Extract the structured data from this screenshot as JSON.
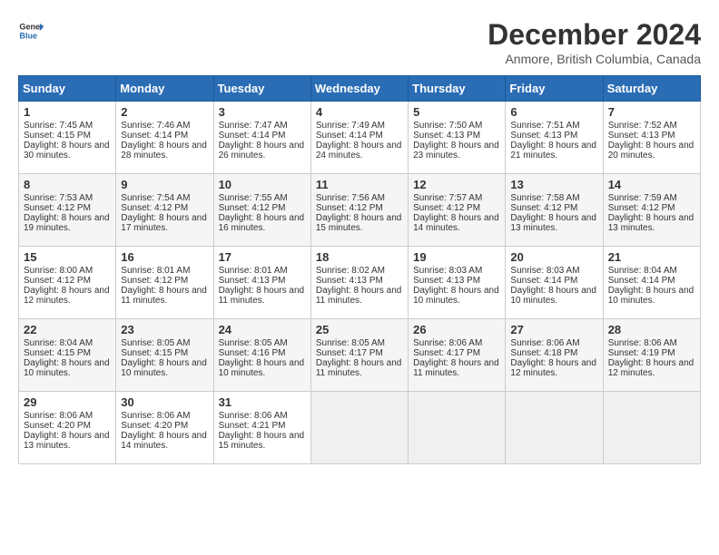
{
  "header": {
    "logo_line1": "General",
    "logo_line2": "Blue",
    "month": "December 2024",
    "location": "Anmore, British Columbia, Canada"
  },
  "weekdays": [
    "Sunday",
    "Monday",
    "Tuesday",
    "Wednesday",
    "Thursday",
    "Friday",
    "Saturday"
  ],
  "weeks": [
    [
      {
        "day": "1",
        "sunrise": "Sunrise: 7:45 AM",
        "sunset": "Sunset: 4:15 PM",
        "daylight": "Daylight: 8 hours and 30 minutes."
      },
      {
        "day": "2",
        "sunrise": "Sunrise: 7:46 AM",
        "sunset": "Sunset: 4:14 PM",
        "daylight": "Daylight: 8 hours and 28 minutes."
      },
      {
        "day": "3",
        "sunrise": "Sunrise: 7:47 AM",
        "sunset": "Sunset: 4:14 PM",
        "daylight": "Daylight: 8 hours and 26 minutes."
      },
      {
        "day": "4",
        "sunrise": "Sunrise: 7:49 AM",
        "sunset": "Sunset: 4:14 PM",
        "daylight": "Daylight: 8 hours and 24 minutes."
      },
      {
        "day": "5",
        "sunrise": "Sunrise: 7:50 AM",
        "sunset": "Sunset: 4:13 PM",
        "daylight": "Daylight: 8 hours and 23 minutes."
      },
      {
        "day": "6",
        "sunrise": "Sunrise: 7:51 AM",
        "sunset": "Sunset: 4:13 PM",
        "daylight": "Daylight: 8 hours and 21 minutes."
      },
      {
        "day": "7",
        "sunrise": "Sunrise: 7:52 AM",
        "sunset": "Sunset: 4:13 PM",
        "daylight": "Daylight: 8 hours and 20 minutes."
      }
    ],
    [
      {
        "day": "8",
        "sunrise": "Sunrise: 7:53 AM",
        "sunset": "Sunset: 4:12 PM",
        "daylight": "Daylight: 8 hours and 19 minutes."
      },
      {
        "day": "9",
        "sunrise": "Sunrise: 7:54 AM",
        "sunset": "Sunset: 4:12 PM",
        "daylight": "Daylight: 8 hours and 17 minutes."
      },
      {
        "day": "10",
        "sunrise": "Sunrise: 7:55 AM",
        "sunset": "Sunset: 4:12 PM",
        "daylight": "Daylight: 8 hours and 16 minutes."
      },
      {
        "day": "11",
        "sunrise": "Sunrise: 7:56 AM",
        "sunset": "Sunset: 4:12 PM",
        "daylight": "Daylight: 8 hours and 15 minutes."
      },
      {
        "day": "12",
        "sunrise": "Sunrise: 7:57 AM",
        "sunset": "Sunset: 4:12 PM",
        "daylight": "Daylight: 8 hours and 14 minutes."
      },
      {
        "day": "13",
        "sunrise": "Sunrise: 7:58 AM",
        "sunset": "Sunset: 4:12 PM",
        "daylight": "Daylight: 8 hours and 13 minutes."
      },
      {
        "day": "14",
        "sunrise": "Sunrise: 7:59 AM",
        "sunset": "Sunset: 4:12 PM",
        "daylight": "Daylight: 8 hours and 13 minutes."
      }
    ],
    [
      {
        "day": "15",
        "sunrise": "Sunrise: 8:00 AM",
        "sunset": "Sunset: 4:12 PM",
        "daylight": "Daylight: 8 hours and 12 minutes."
      },
      {
        "day": "16",
        "sunrise": "Sunrise: 8:01 AM",
        "sunset": "Sunset: 4:12 PM",
        "daylight": "Daylight: 8 hours and 11 minutes."
      },
      {
        "day": "17",
        "sunrise": "Sunrise: 8:01 AM",
        "sunset": "Sunset: 4:13 PM",
        "daylight": "Daylight: 8 hours and 11 minutes."
      },
      {
        "day": "18",
        "sunrise": "Sunrise: 8:02 AM",
        "sunset": "Sunset: 4:13 PM",
        "daylight": "Daylight: 8 hours and 11 minutes."
      },
      {
        "day": "19",
        "sunrise": "Sunrise: 8:03 AM",
        "sunset": "Sunset: 4:13 PM",
        "daylight": "Daylight: 8 hours and 10 minutes."
      },
      {
        "day": "20",
        "sunrise": "Sunrise: 8:03 AM",
        "sunset": "Sunset: 4:14 PM",
        "daylight": "Daylight: 8 hours and 10 minutes."
      },
      {
        "day": "21",
        "sunrise": "Sunrise: 8:04 AM",
        "sunset": "Sunset: 4:14 PM",
        "daylight": "Daylight: 8 hours and 10 minutes."
      }
    ],
    [
      {
        "day": "22",
        "sunrise": "Sunrise: 8:04 AM",
        "sunset": "Sunset: 4:15 PM",
        "daylight": "Daylight: 8 hours and 10 minutes."
      },
      {
        "day": "23",
        "sunrise": "Sunrise: 8:05 AM",
        "sunset": "Sunset: 4:15 PM",
        "daylight": "Daylight: 8 hours and 10 minutes."
      },
      {
        "day": "24",
        "sunrise": "Sunrise: 8:05 AM",
        "sunset": "Sunset: 4:16 PM",
        "daylight": "Daylight: 8 hours and 10 minutes."
      },
      {
        "day": "25",
        "sunrise": "Sunrise: 8:05 AM",
        "sunset": "Sunset: 4:17 PM",
        "daylight": "Daylight: 8 hours and 11 minutes."
      },
      {
        "day": "26",
        "sunrise": "Sunrise: 8:06 AM",
        "sunset": "Sunset: 4:17 PM",
        "daylight": "Daylight: 8 hours and 11 minutes."
      },
      {
        "day": "27",
        "sunrise": "Sunrise: 8:06 AM",
        "sunset": "Sunset: 4:18 PM",
        "daylight": "Daylight: 8 hours and 12 minutes."
      },
      {
        "day": "28",
        "sunrise": "Sunrise: 8:06 AM",
        "sunset": "Sunset: 4:19 PM",
        "daylight": "Daylight: 8 hours and 12 minutes."
      }
    ],
    [
      {
        "day": "29",
        "sunrise": "Sunrise: 8:06 AM",
        "sunset": "Sunset: 4:20 PM",
        "daylight": "Daylight: 8 hours and 13 minutes."
      },
      {
        "day": "30",
        "sunrise": "Sunrise: 8:06 AM",
        "sunset": "Sunset: 4:20 PM",
        "daylight": "Daylight: 8 hours and 14 minutes."
      },
      {
        "day": "31",
        "sunrise": "Sunrise: 8:06 AM",
        "sunset": "Sunset: 4:21 PM",
        "daylight": "Daylight: 8 hours and 15 minutes."
      },
      null,
      null,
      null,
      null
    ]
  ]
}
